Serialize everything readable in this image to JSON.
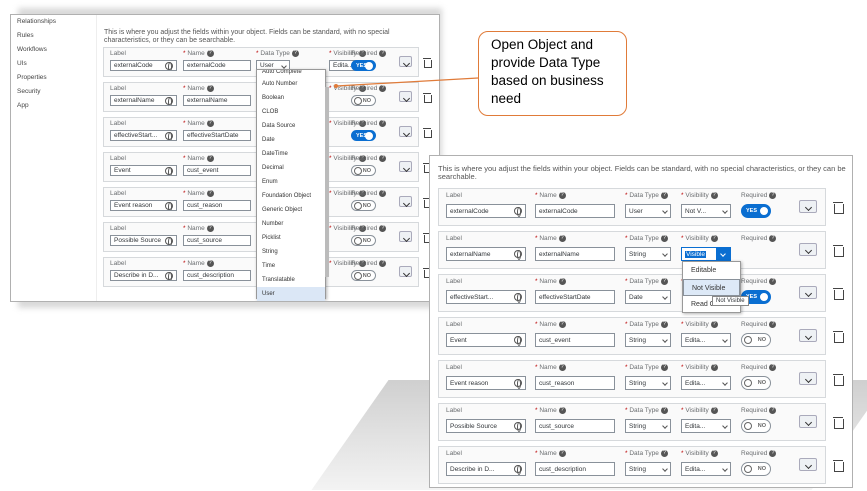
{
  "panel1": {
    "sidebar": [
      "Relationships",
      "Rules",
      "Workflows",
      "UIs",
      "Properties",
      "Security",
      "App"
    ],
    "intro": "This is where you adjust the fields within your object. Fields can be standard, with no special characteristics, or they can be searchable.",
    "headers": {
      "label": "Label",
      "name": "Name",
      "data_type": "Data Type",
      "visibility": "Visibility",
      "required": "Required"
    },
    "rows": [
      {
        "label": "externalCode",
        "name": "externalCode",
        "type": "User",
        "vis": "Edita...",
        "req": "YES"
      },
      {
        "label": "externalName",
        "name": "externalName",
        "type": "",
        "vis": "",
        "req": "NO"
      },
      {
        "label": "effectiveStart...",
        "name": "effectiveStartDate",
        "type": "",
        "vis": "",
        "req": "YES"
      },
      {
        "label": "Event",
        "name": "cust_event",
        "type": "",
        "vis": "",
        "req": "NO"
      },
      {
        "label": "Event reason",
        "name": "cust_reason",
        "type": "",
        "vis": "",
        "req": "NO"
      },
      {
        "label": "Possible Source",
        "name": "cust_source",
        "type": "",
        "vis": "",
        "req": "NO"
      },
      {
        "label": "Describe in D...",
        "name": "cust_description",
        "type": "",
        "vis": "",
        "req": "NO"
      }
    ],
    "datatype_options": [
      "Auto Complete",
      "Auto Number",
      "Boolean",
      "CLOB",
      "Data Source",
      "Date",
      "DateTime",
      "Decimal",
      "Enum",
      "Foundation Object",
      "Generic Object",
      "Number",
      "Picklist",
      "String",
      "Time",
      "Translatable",
      "User"
    ]
  },
  "panel2": {
    "intro": "This is where you adjust the fields within your object. Fields can be standard, with no special characteristics, or they can be searchable.",
    "headers": {
      "label": "Label",
      "name": "Name",
      "data_type": "Data Type",
      "visibility": "Visibility",
      "required": "Required"
    },
    "rows": [
      {
        "label": "externalCode",
        "name": "externalCode",
        "type": "User",
        "vis": "Not V...",
        "req": "YES"
      },
      {
        "label": "externalName",
        "name": "externalName",
        "type": "String",
        "vis": "Visible",
        "req": ""
      },
      {
        "label": "effectiveStart...",
        "name": "effectiveStartDate",
        "type": "Date",
        "vis": "",
        "req": "YES"
      },
      {
        "label": "Event",
        "name": "cust_event",
        "type": "String",
        "vis": "Edita...",
        "req": "NO"
      },
      {
        "label": "Event reason",
        "name": "cust_reason",
        "type": "String",
        "vis": "Edita...",
        "req": "NO"
      },
      {
        "label": "Possible Source",
        "name": "cust_source",
        "type": "String",
        "vis": "Edita...",
        "req": "NO"
      },
      {
        "label": "Describe in D...",
        "name": "cust_description",
        "type": "String",
        "vis": "Edita...",
        "req": "NO"
      }
    ],
    "visibility_options": [
      "Editable",
      "Not Visible",
      "Read O"
    ],
    "tooltip": "Not Visible"
  },
  "callout": "Open Object and provide Data Type based on business need",
  "colors": {
    "accent": "#0a6ed1",
    "callout_border": "#e07b39",
    "required": "#bb0000"
  }
}
